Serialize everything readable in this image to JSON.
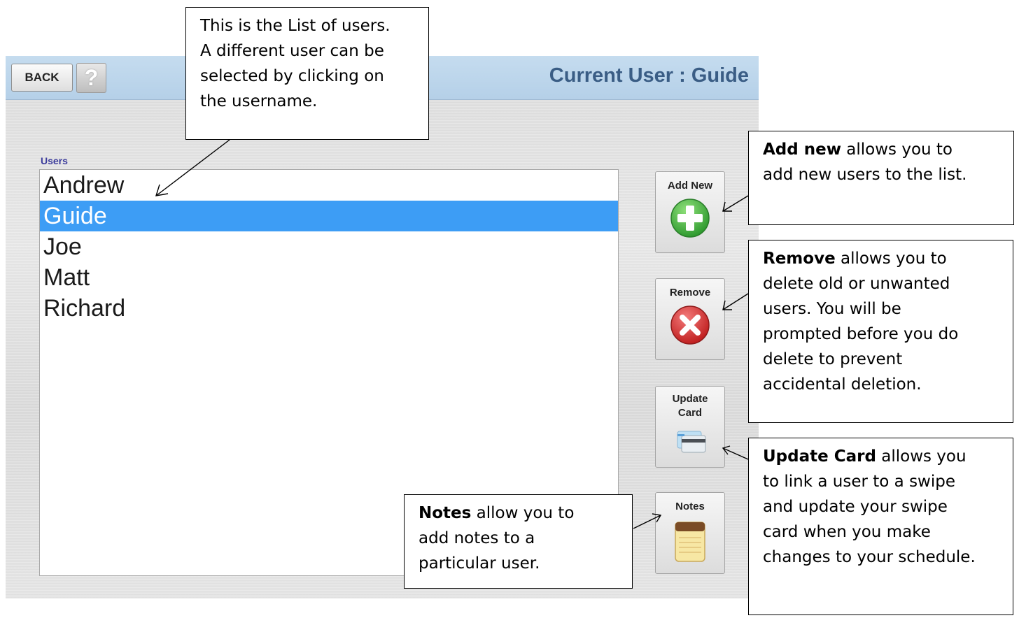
{
  "toolbar": {
    "back_label": "BACK",
    "help_label": "?",
    "current_user_text": "Current User : Guide"
  },
  "users": {
    "label": "Users",
    "items": [
      "Andrew",
      "Guide",
      "Joe",
      "Matt",
      "Richard"
    ],
    "selected": "Guide"
  },
  "buttons": {
    "add_new": {
      "label": "Add New",
      "icon": "plus-icon",
      "color": "#3aa83a"
    },
    "remove": {
      "label": "Remove",
      "icon": "close-icon",
      "color": "#d02f2f"
    },
    "update_card": {
      "label_line1": "Update",
      "label_line2": "Card",
      "icon": "card-icon"
    },
    "notes": {
      "label": "Notes",
      "icon": "notepad-icon"
    }
  },
  "callouts": {
    "list": {
      "lines": [
        "This is the List of users.",
        "A different user can be",
        "selected by clicking on",
        "the username."
      ]
    },
    "add_new": {
      "title": "Add new",
      "line1_rest": " allows you to",
      "lines": [
        "add new users to the list."
      ]
    },
    "remove": {
      "title": "Remove",
      "line1_rest": " allows you to",
      "lines": [
        "delete old or unwanted",
        "users. You will be",
        "prompted before you do",
        "delete to prevent",
        "accidental deletion."
      ]
    },
    "update_card": {
      "title": "Update Card",
      "line1_rest": " allows you",
      "lines": [
        "to link a user to a swipe",
        "and update your swipe",
        "card when you make",
        "changes to your schedule."
      ]
    },
    "notes": {
      "title": "Notes",
      "line1_rest": " allow you to",
      "lines": [
        "add notes to a",
        "particular user."
      ]
    }
  }
}
